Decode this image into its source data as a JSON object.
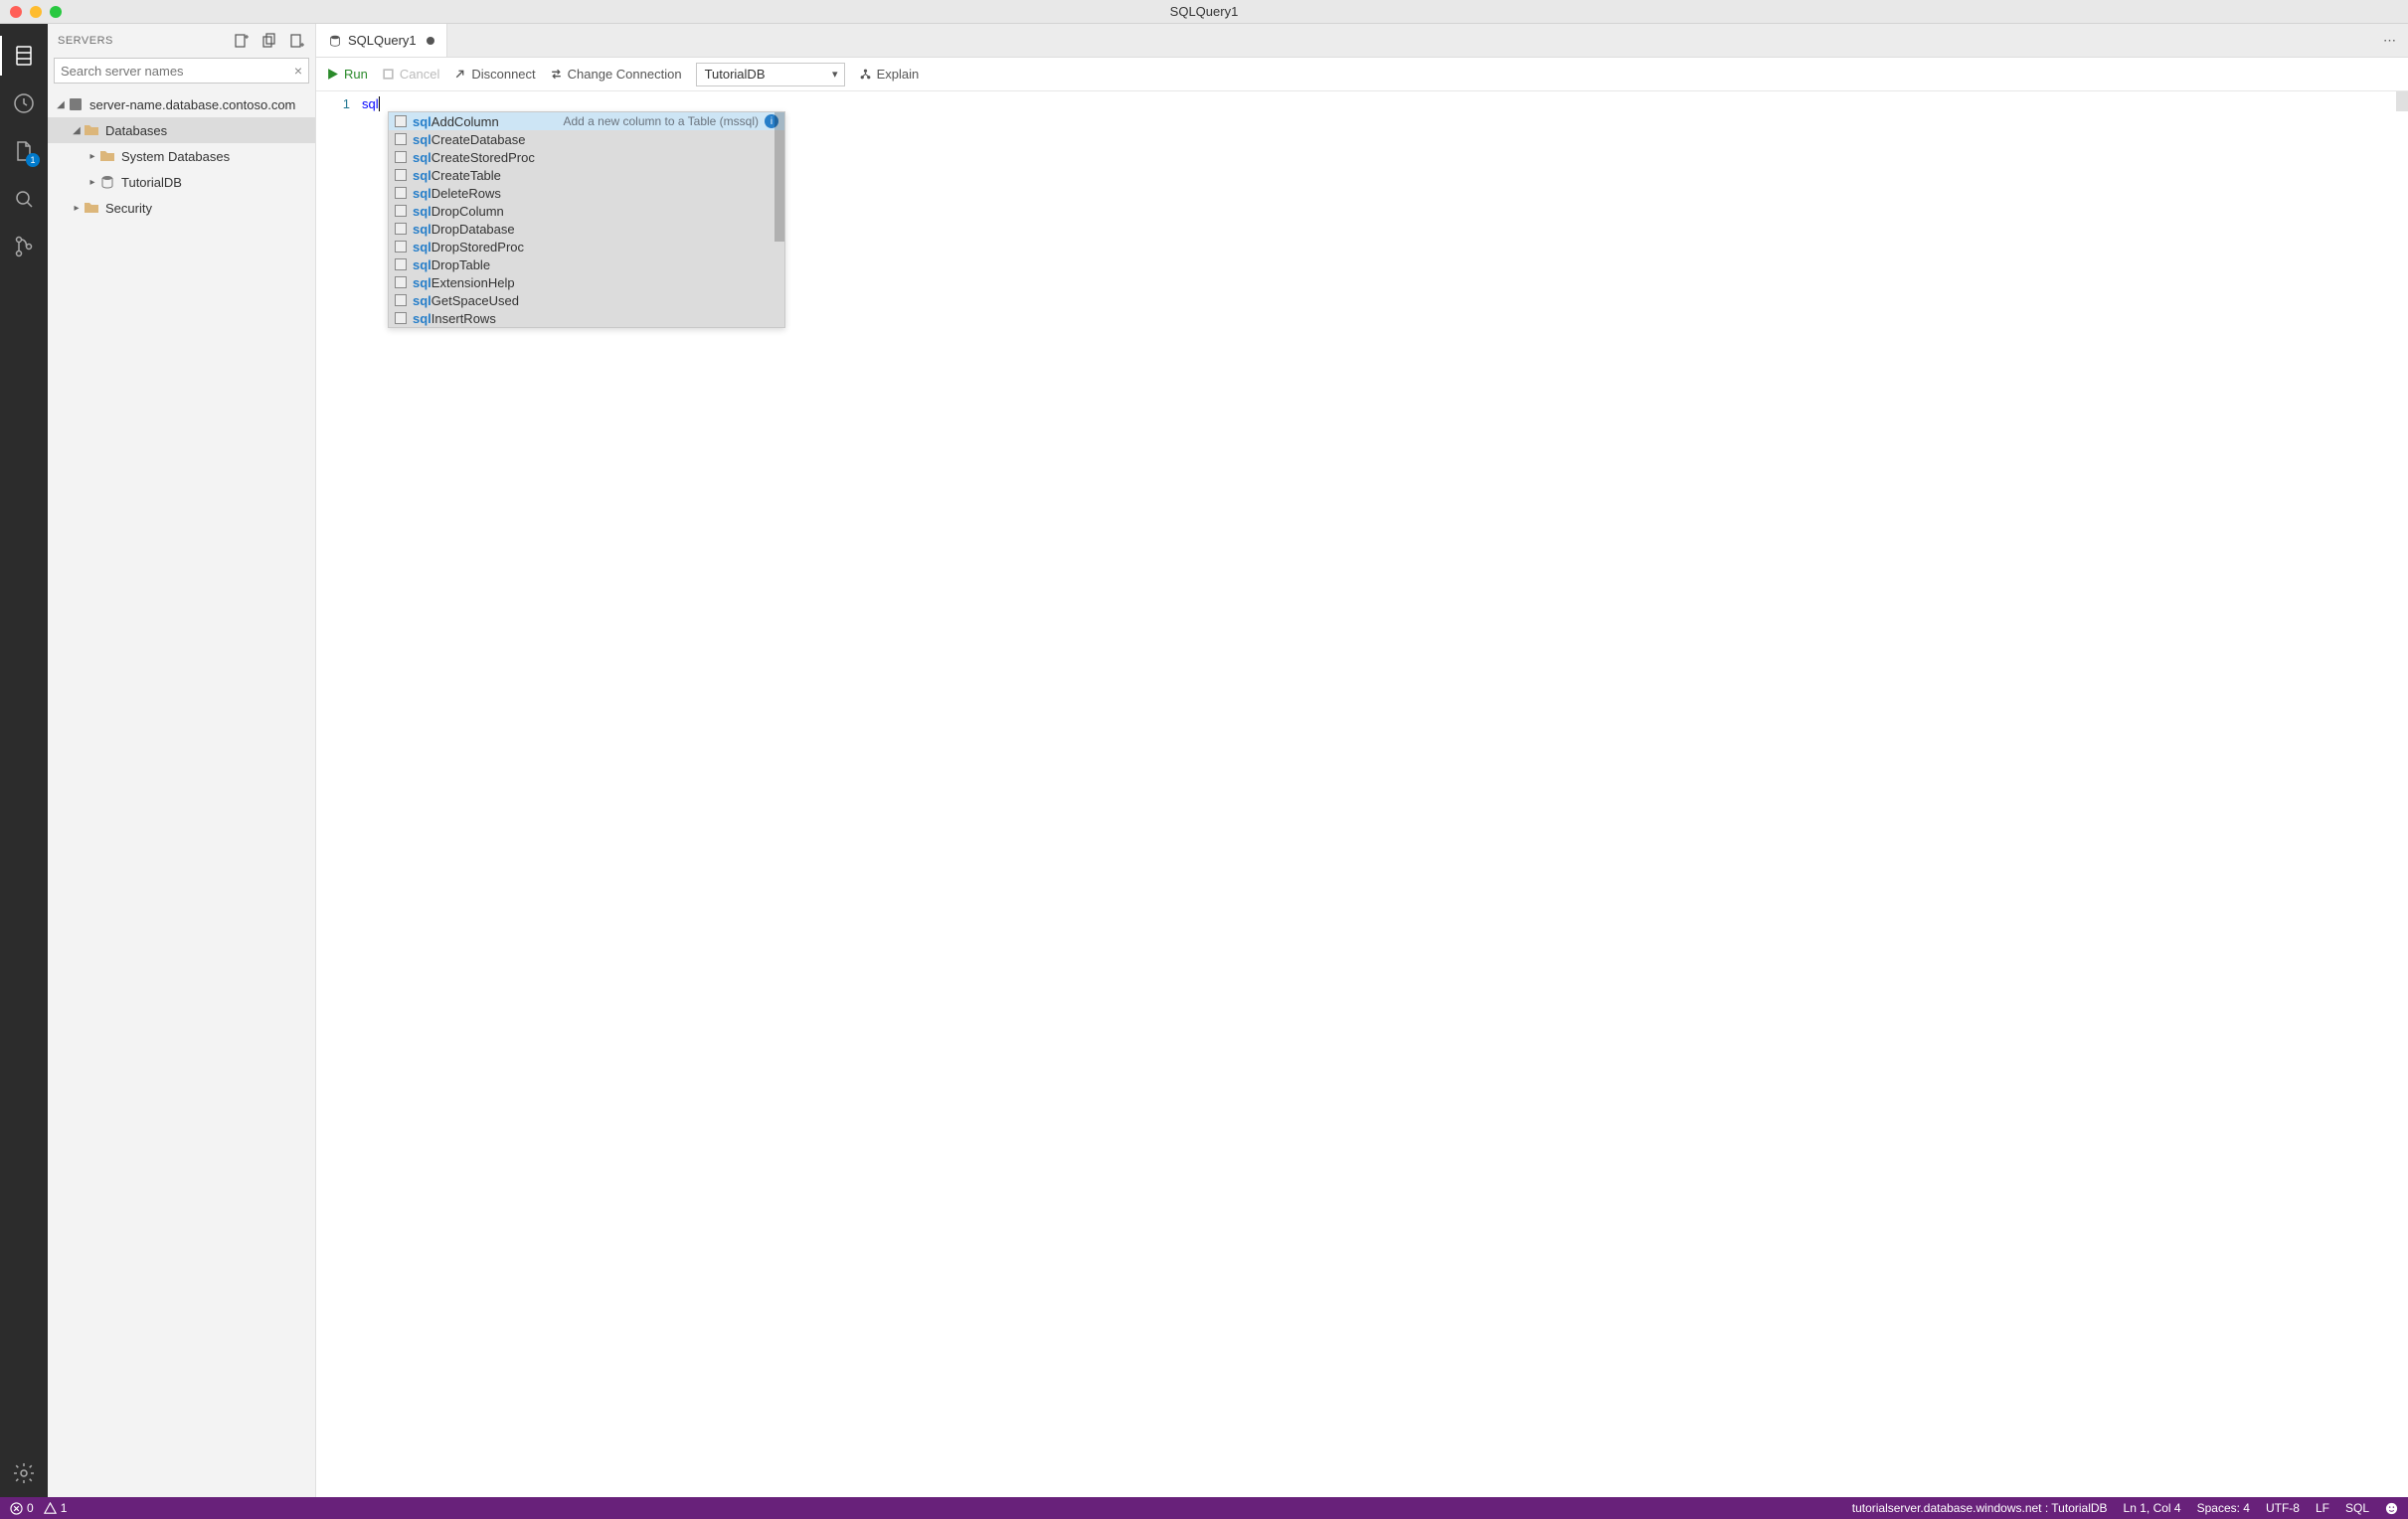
{
  "window": {
    "title": "SQLQuery1"
  },
  "activityBar": {
    "file_badge": "1"
  },
  "sidebar": {
    "title": "SERVERS",
    "search_placeholder": "Search server names",
    "tree": {
      "server": "server-name.database.contoso.com",
      "databases_label": "Databases",
      "system_databases_label": "System Databases",
      "tutorial_db_label": "TutorialDB",
      "security_label": "Security"
    }
  },
  "editor": {
    "tab_label": "SQLQuery1",
    "line_number": "1",
    "code_text": "sql"
  },
  "toolbar": {
    "run": "Run",
    "cancel": "Cancel",
    "disconnect": "Disconnect",
    "change_connection": "Change Connection",
    "db_selected": "TutorialDB",
    "explain": "Explain"
  },
  "intellisense": {
    "description": "Add a new column to a Table (mssql)",
    "match_prefix": "sql",
    "items": [
      "AddColumn",
      "CreateDatabase",
      "CreateStoredProc",
      "CreateTable",
      "DeleteRows",
      "DropColumn",
      "DropDatabase",
      "DropStoredProc",
      "DropTable",
      "ExtensionHelp",
      "GetSpaceUsed",
      "InsertRows"
    ]
  },
  "status": {
    "errors": "0",
    "warnings": "1",
    "connection": "tutorialserver.database.windows.net : TutorialDB",
    "cursor": "Ln 1, Col 4",
    "spaces": "Spaces: 4",
    "encoding": "UTF-8",
    "eol": "LF",
    "language": "SQL"
  }
}
